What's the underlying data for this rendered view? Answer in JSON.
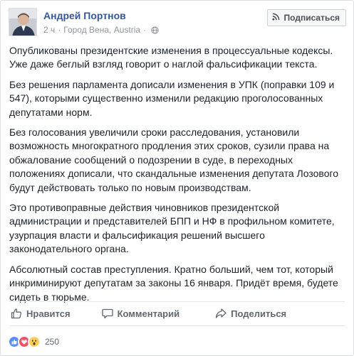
{
  "post": {
    "author": "Андрей Портнов",
    "time": "2 ч",
    "dot": "·",
    "location": "Город Вена, Austria",
    "subscribe_label": "Подписаться",
    "paragraphs": [
      "Опубликованы президентские изменения в процессуальные кодексы. Уже даже беглый взгляд говорит о наглой фальсификации текста.",
      "Без решения парламента дописали изменения в УПК (поправки 109 и 547), которыми существенно изменили редакцию проголосованных депутатами норм.",
      "Без голосования увеличили сроки расследования, установили возможность многократного продления этих сроков, сузили права на обжалование сообщений о подозрении в суде, в переходных положениях дописали, что скандальные изменения депутата Лозового будут действовать только по новым производствам.",
      "Это противоправные действия чиновников президентской администрации и представителей БПП и НФ в профильном комитете, узурпация власти и фальсификация решений высшего законодательного органа.",
      "Абсолютный состав преступления. Кратно больший, чем тот, который инкриминируют депутатам за законы 16 января. Придёт время, будете сидеть в тюрьме."
    ]
  },
  "actions": {
    "like": "Нравится",
    "comment": "Комментарий",
    "share": "Поделиться"
  },
  "reactions": {
    "icons": [
      "like-reaction-icon",
      "love-reaction-icon",
      "wow-reaction-icon"
    ],
    "count": "250",
    "colors": {
      "like": "#5890ff",
      "love": "#f25268",
      "wow": "#fcd05b"
    }
  },
  "colors": {
    "link": "#365899",
    "meta": "#90949c",
    "text": "#1d2129"
  }
}
